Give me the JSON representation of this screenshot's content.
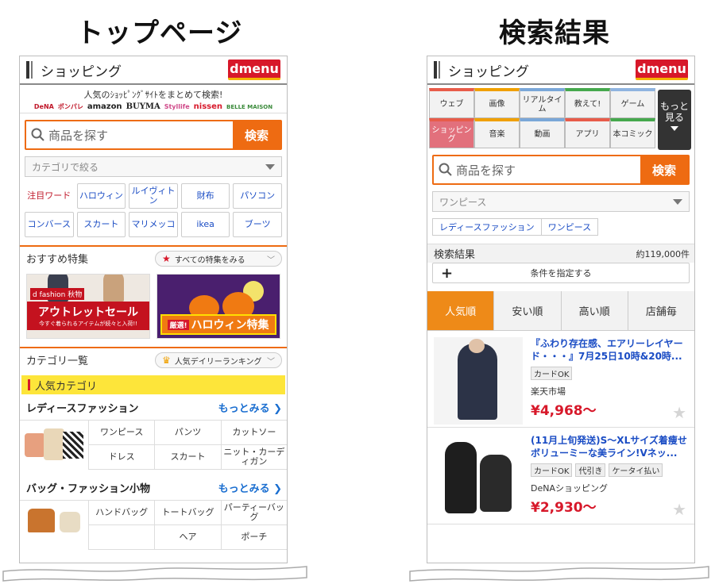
{
  "headings": {
    "left": "トップページ",
    "right": "検索結果"
  },
  "appbar": {
    "title": "ショッピング",
    "logo": "dmenu"
  },
  "top": {
    "promo_text": "人気のｼｮｯﾋﾟﾝｸﾞｻｲﾄをまとめて検索!",
    "promo_logos": [
      "DeNA",
      "ポンパレ",
      "amazon",
      "BUYMA",
      "Styllife",
      "nissen",
      "BELLE MAISON"
    ],
    "search": {
      "placeholder": "商品を探す",
      "button": "検索"
    },
    "category_select": "カテゴリで絞る",
    "keywords_label": "注目ワード",
    "keywords": [
      "ハロウィン",
      "ルイヴィトン",
      "財布",
      "パソコン",
      "コンバース",
      "スカート",
      "マリメッコ",
      "ikea",
      "ブーツ"
    ],
    "featured": {
      "title": "おすすめ特集",
      "see_all": "すべての特集をみる"
    },
    "banners": {
      "outlet": {
        "brand": "d fashion 秋物",
        "title": "アウトレットセール",
        "sub": "今すぐ着られるアイテムが続々と入荷!!"
      },
      "halloween": {
        "title": "ハロウィン特集",
        "badge": "厳選!"
      }
    },
    "category_list": {
      "title": "カテゴリ一覧",
      "ranking": "人気デイリーランキング"
    },
    "popular_header": "人気カテゴリ",
    "categories": [
      {
        "name": "レディースファッション",
        "more": "もっとみる ❯",
        "items": [
          "ワンピース",
          "パンツ",
          "カットソー",
          "ドレス",
          "スカート",
          "ニット・カーディガン"
        ]
      },
      {
        "name": "バッグ・ファッション小物",
        "more": "もっとみる ❯",
        "items": [
          "ハンドバッグ",
          "トートバッグ",
          "パーティーバッグ",
          "",
          "ヘア",
          "ポーチ"
        ]
      }
    ]
  },
  "results": {
    "tabs": [
      "ウェブ",
      "画像",
      "リアルタイム",
      "教えて!",
      "ゲーム",
      "ショッピング",
      "音楽",
      "動画",
      "アプリ",
      "本コミック"
    ],
    "tab_colors": [
      "#e85c4a",
      "#f0a000",
      "#7aa7d8",
      "#45a84d",
      "#8fb4e0",
      "#e85c4a",
      "#f0a000",
      "#7aa7d8",
      "#e85c4a",
      "#45a84d"
    ],
    "more_tab": "もっと見る",
    "search": {
      "placeholder": "商品を探す",
      "button": "検索"
    },
    "select_value": "ワンピース",
    "breadcrumbs": [
      "レディースファッション",
      "ワンピース"
    ],
    "header": "検索結果",
    "count": "約119,000件",
    "conditions": "条件を指定する",
    "sorts": [
      "人気順",
      "安い順",
      "高い順",
      "店舗毎"
    ],
    "items": [
      {
        "title": "『ふわり存在感、エアリーレイヤード・・・』7月25日10時&20時...",
        "tags": [
          "カードOK"
        ],
        "shop": "楽天市場",
        "price": "¥4,968〜"
      },
      {
        "title": "(11月上旬発送)S〜XLサイズ着痩せボリューミーな美ライン!Vネッ...",
        "tags": [
          "カードOK",
          "代引き",
          "ケータイ払い"
        ],
        "shop": "DeNAショッピング",
        "price": "¥2,930〜"
      }
    ]
  }
}
